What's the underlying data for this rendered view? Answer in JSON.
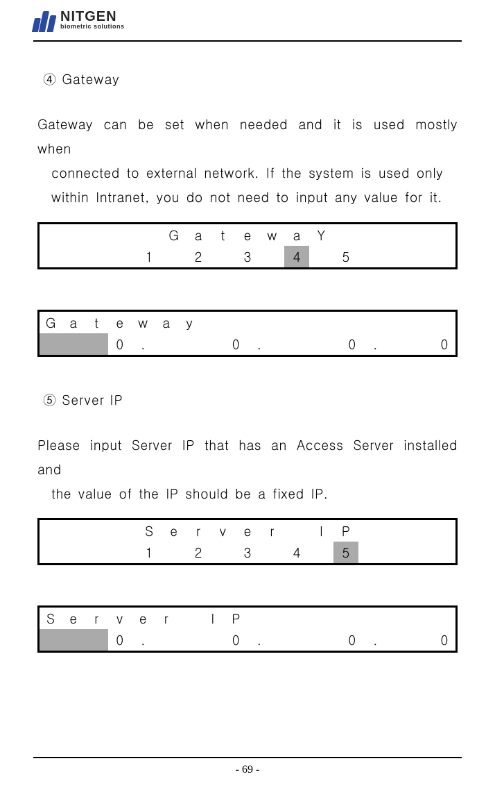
{
  "header": {
    "brand_main": "NITGEN",
    "brand_sub": "biometric solutions"
  },
  "section4": {
    "title": "④ Gateway",
    "para_line1": "Gateway can be set when needed and it is used mostly when",
    "para_line2": "connected to external network. If the system is used only",
    "para_line3": "within Intranet, you do not need to input any value for it.",
    "lcd_menu": {
      "row1": [
        "",
        "",
        "",
        "",
        "",
        "G",
        "a",
        "t",
        "e",
        "w",
        "a",
        "Y",
        "",
        "",
        "",
        "",
        ""
      ],
      "row2": [
        "",
        "",
        "",
        "",
        "1",
        "",
        "2",
        "",
        "3",
        "",
        "4",
        "",
        "5",
        "",
        "",
        "",
        ""
      ],
      "highlight": 10
    },
    "lcd_value": {
      "row1": [
        "G",
        "a",
        "t",
        "e",
        "w",
        "a",
        "y",
        "",
        "",
        "",
        "",
        "",
        "",
        "",
        "",
        "",
        ""
      ],
      "row2": [
        "",
        "",
        "",
        "0",
        ".",
        "",
        "",
        "",
        "0",
        ".",
        "",
        "",
        "",
        "0",
        ".",
        "",
        "",
        "0"
      ],
      "hl_cols": [
        0,
        1,
        2
      ]
    }
  },
  "section5": {
    "title": "⑤ Server IP",
    "para_line1": "Please input Server IP that has an Access Server installed and",
    "para_line2": "the value of the IP should be a fixed IP.",
    "lcd_menu": {
      "row1": [
        "",
        "",
        "",
        "",
        "S",
        "e",
        "r",
        "v",
        "e",
        "r",
        "",
        "I",
        "P",
        "",
        "",
        "",
        ""
      ],
      "row2": [
        "",
        "",
        "",
        "",
        "1",
        "",
        "2",
        "",
        "3",
        "",
        "4",
        "",
        "5",
        "",
        "",
        "",
        ""
      ],
      "highlight": 12
    },
    "lcd_value": {
      "row1": [
        "S",
        "e",
        "r",
        "v",
        "e",
        "r",
        "",
        "I",
        "P",
        "",
        "",
        "",
        "",
        "",
        "",
        "",
        ""
      ],
      "row2": [
        "",
        "",
        "",
        "0",
        ".",
        "",
        "",
        "",
        "0",
        ".",
        "",
        "",
        "",
        "0",
        ".",
        "",
        "",
        "0"
      ],
      "hl_cols": [
        0,
        1,
        2
      ]
    }
  },
  "footer": {
    "page": "- 69 -"
  }
}
